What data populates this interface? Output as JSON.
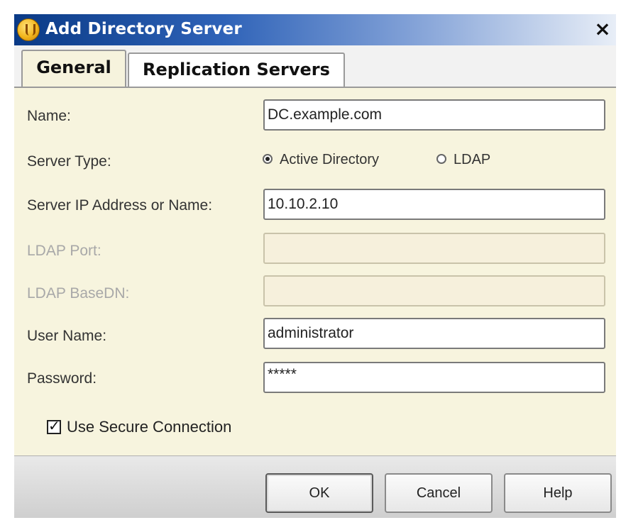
{
  "window": {
    "title": "Add Directory Server",
    "close_glyph": "×",
    "icon": "app-shield-icon"
  },
  "tabs": [
    {
      "label": "General",
      "selected": true
    },
    {
      "label": "Replication Servers",
      "selected": false
    }
  ],
  "form": {
    "name": {
      "label": "Name:",
      "value": "DC.example.com"
    },
    "server_type": {
      "label": "Server Type:",
      "options": [
        {
          "label": "Active Directory",
          "selected": true
        },
        {
          "label": "LDAP",
          "selected": false
        }
      ]
    },
    "server_ip": {
      "label": "Server IP Address or Name:",
      "value": "10.10.2.10"
    },
    "ldap_port": {
      "label": "LDAP Port:",
      "value": "",
      "enabled": false
    },
    "ldap_basedn": {
      "label": "LDAP BaseDN:",
      "value": "",
      "enabled": false
    },
    "user_name": {
      "label": "User Name:",
      "value": "administrator"
    },
    "password": {
      "label": "Password:",
      "value": "*****"
    },
    "secure_connection": {
      "label": "Use Secure Connection",
      "checked": true,
      "check_glyph": "✓"
    }
  },
  "buttons": {
    "ok": "OK",
    "cancel": "Cancel",
    "help": "Help"
  },
  "colors": {
    "titlebar_start": "#0a3a86",
    "panel_bg": "#f7f4de",
    "disabled_text": "#a8a8a8"
  }
}
